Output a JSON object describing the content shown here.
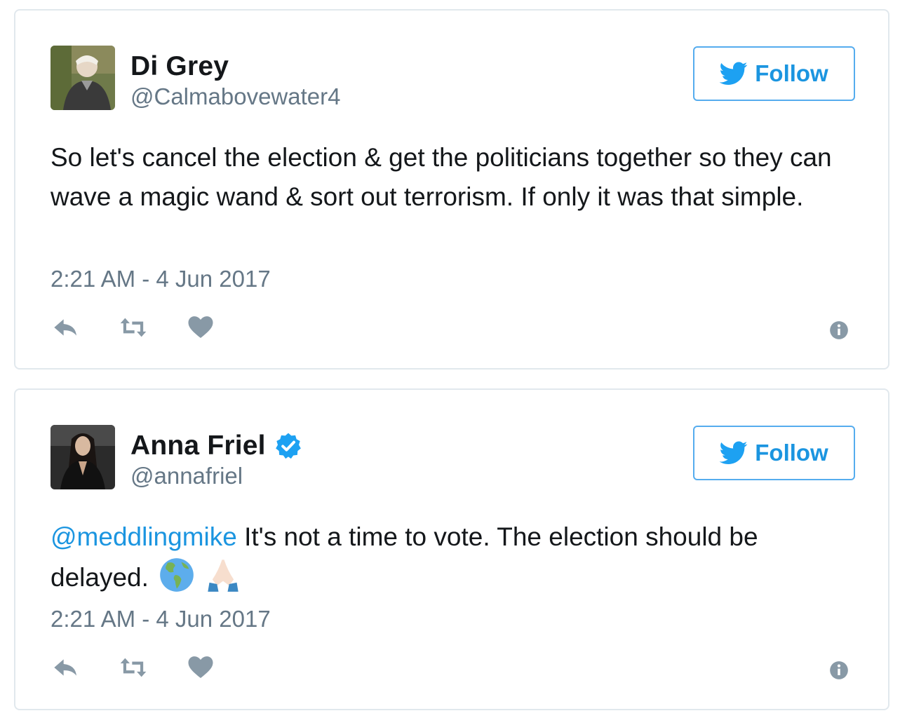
{
  "tweets": [
    {
      "display_name": "Di Grey",
      "handle": "@Calmabovewater4",
      "verified": false,
      "follow_label": "Follow",
      "text": "So let's cancel the election & get the politicians together so they can wave a magic wand & sort out terrorism. If only it was that simple.",
      "timestamp": "2:21 AM - 4 Jun 2017"
    },
    {
      "display_name": "Anna Friel",
      "handle": "@annafriel",
      "verified": true,
      "follow_label": "Follow",
      "mention": "@meddlingmike",
      "text": " It's not a time to vote. The election should be delayed.",
      "emojis": [
        "globe-americas-icon",
        "folded-hands-icon"
      ],
      "timestamp": "2:21 AM - 4 Jun 2017"
    }
  ],
  "icons": [
    "reply-icon",
    "retweet-icon",
    "heart-icon",
    "info-icon",
    "twitter-bird-icon",
    "verified-badge-icon"
  ],
  "colors": {
    "accent": "#1b95e0",
    "follow_border": "#55acee",
    "secondary_text": "#657786",
    "icon_gray": "#8899a6",
    "card_border": "#e1e8ed",
    "verified": "#1da1f2"
  }
}
